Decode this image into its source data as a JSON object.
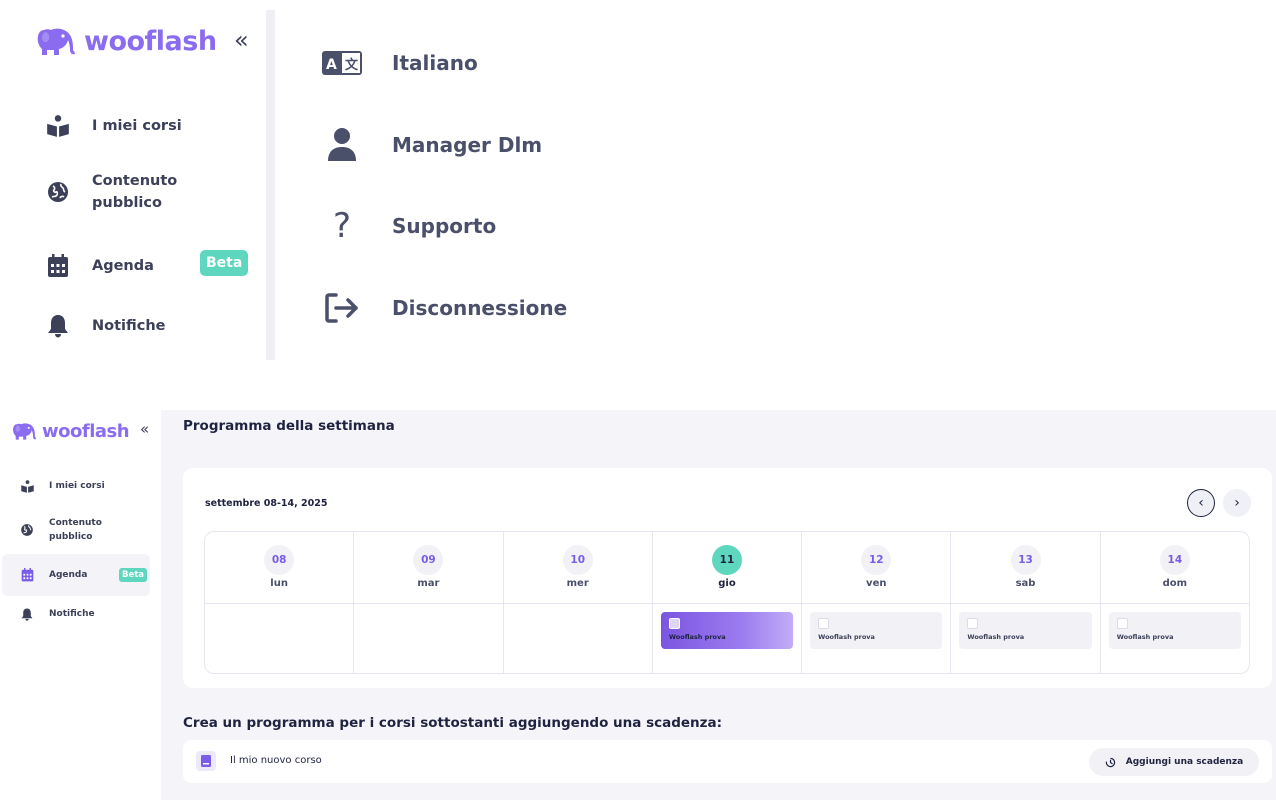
{
  "brand": {
    "name": "wooflash",
    "color": "#8b6cf0"
  },
  "sidebar": {
    "items": [
      {
        "label": "I miei corsi",
        "icon": "book-reader-icon"
      },
      {
        "label": "Contenuto\npubblico",
        "icon": "globe-icon"
      },
      {
        "label": "Agenda",
        "icon": "calendar-icon",
        "badge": "Beta",
        "active": true
      },
      {
        "label": "Notifiche",
        "icon": "bell-icon"
      }
    ],
    "badge_color": "#5fd6be"
  },
  "user_menu": {
    "items": [
      {
        "label": "Italiano",
        "icon": "language-icon"
      },
      {
        "label": "Manager Dlm",
        "icon": "user-icon"
      },
      {
        "label": "Supporto",
        "icon": "question-icon"
      },
      {
        "label": "Disconnessione",
        "icon": "logout-icon"
      }
    ]
  },
  "main": {
    "title": "Programma della settimana",
    "week_label": "settembre 08-14, 2025",
    "days": [
      {
        "num": "08",
        "name": "lun",
        "today": false,
        "event": null
      },
      {
        "num": "09",
        "name": "mar",
        "today": false,
        "event": null
      },
      {
        "num": "10",
        "name": "mer",
        "today": false,
        "event": null
      },
      {
        "num": "11",
        "name": "gio",
        "today": true,
        "event": {
          "name": "Wooflash prova",
          "primary": true
        }
      },
      {
        "num": "12",
        "name": "ven",
        "today": false,
        "event": {
          "name": "Wooflash prova",
          "primary": false
        }
      },
      {
        "num": "13",
        "name": "sab",
        "today": false,
        "event": {
          "name": "Wooflash prova",
          "primary": false
        }
      },
      {
        "num": "14",
        "name": "dom",
        "today": false,
        "event": {
          "name": "Wooflash prova",
          "primary": false
        }
      }
    ],
    "subtitle": "Crea un programma per i corsi sottostanti aggiungendo una scadenza:",
    "course": {
      "name": "Il mio nuovo corso",
      "action_label": "Aggiungi una scadenza"
    },
    "today_color": "#5fd6be",
    "accent_color": "#7b55e0"
  }
}
